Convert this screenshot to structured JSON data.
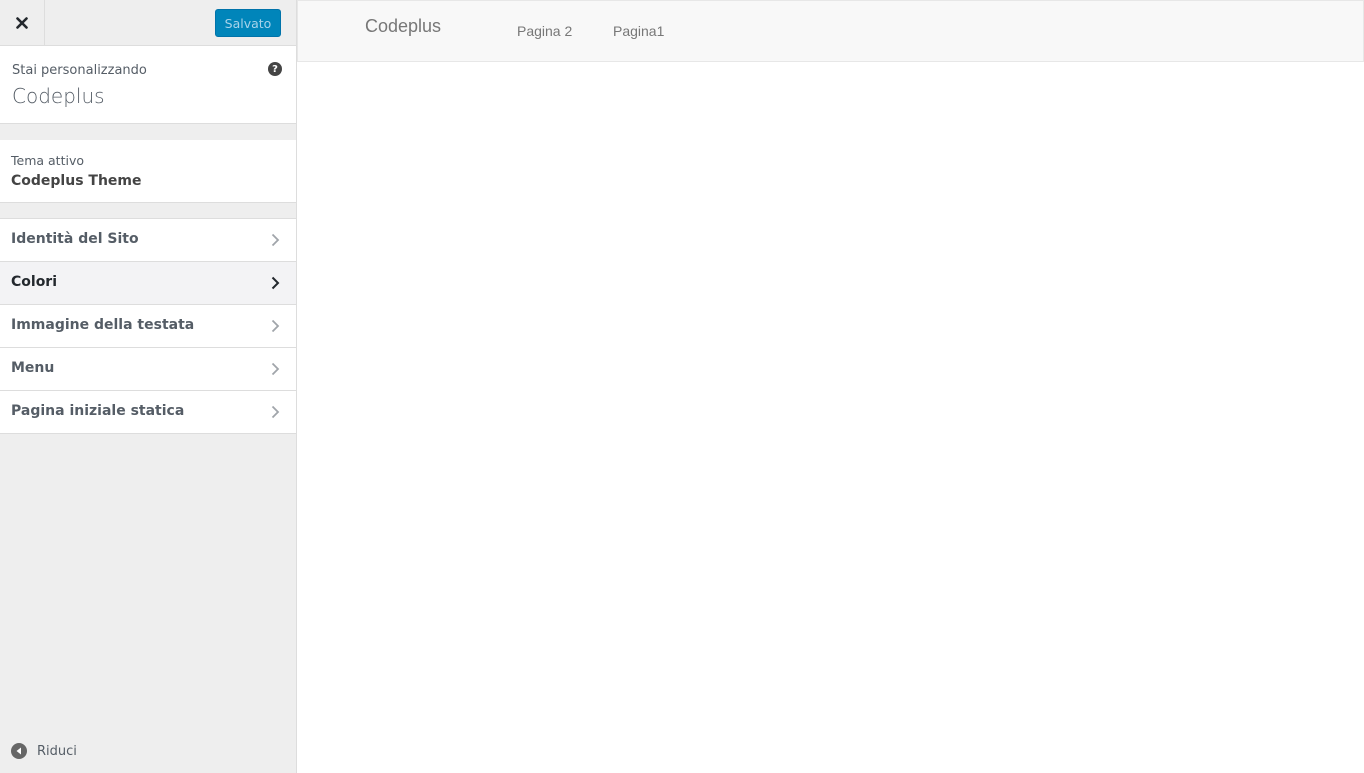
{
  "customizer": {
    "close_symbol": "×",
    "save_label": "Salvato",
    "info": {
      "action_text": "Stai personalizzando",
      "site_title": "Codeplus",
      "help_symbol": "?"
    },
    "theme": {
      "label": "Tema attivo",
      "name": "Codeplus Theme"
    },
    "sections": [
      {
        "label": "Identità del Sito",
        "icon": "chevron-right-icon"
      },
      {
        "label": "Colori",
        "icon": "chevron-right-icon",
        "active": true
      },
      {
        "label": "Immagine della testata",
        "icon": "chevron-right-icon"
      },
      {
        "label": "Menu",
        "icon": "chevron-right-icon"
      },
      {
        "label": "Pagina iniziale statica",
        "icon": "chevron-right-icon"
      }
    ],
    "collapse_label": "Riduci"
  },
  "preview": {
    "brand": "Codeplus",
    "nav": [
      "Pagina 2",
      "Pagina1"
    ]
  },
  "colors": {
    "accent": "#0085ba",
    "sidebar_bg": "#eeeeee",
    "navbar_bg": "#f8f8f8"
  }
}
